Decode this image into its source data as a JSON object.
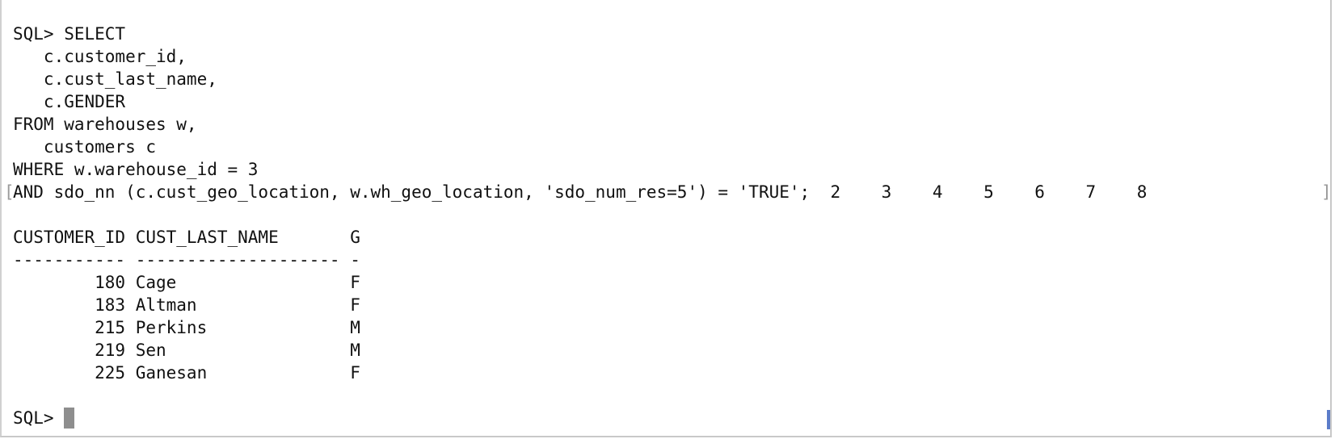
{
  "terminal": {
    "lines": [
      "SQL> SELECT",
      "   c.customer_id,",
      "   c.cust_last_name,",
      "   c.GENDER",
      "FROM warehouses w,",
      "   customers c",
      "WHERE w.warehouse_id = 3",
      "AND sdo_nn (c.cust_geo_location, w.wh_geo_location, 'sdo_num_res=5') = 'TRUE';  2    3    4    5    6    7    8",
      "",
      "CUSTOMER_ID CUST_LAST_NAME       G",
      "----------- -------------------- -",
      "        180 Cage                 F",
      "        183 Altman               F",
      "        215 Perkins              M",
      "        219 Sen                  M",
      "        225 Ganesan              F",
      "",
      "SQL> "
    ],
    "bracket_left": "[",
    "bracket_right": "]"
  }
}
